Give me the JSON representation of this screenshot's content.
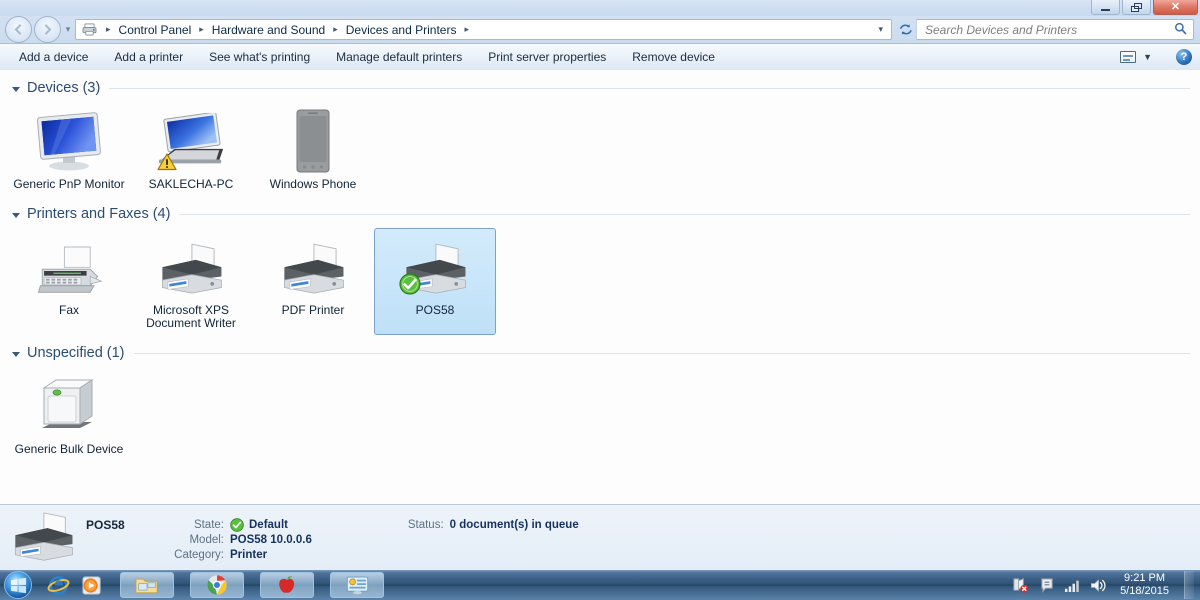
{
  "window": {
    "titlebar_buttons": {
      "minimize": "–",
      "restore": "❐",
      "close": "✕"
    }
  },
  "addressbar": {
    "back_glyph": "◄",
    "forward_glyph": "►",
    "history_glyph": "▼",
    "crumb_icon": "printer-folder-icon",
    "crumbs": [
      "Control Panel",
      "Hardware and Sound",
      "Devices and Printers"
    ],
    "separator": "►",
    "dropdown_glyph": "▼",
    "refresh_glyph": "↻",
    "search_placeholder": "Search Devices and Printers",
    "search_icon": "🔍"
  },
  "toolbar": {
    "items": [
      "Add a device",
      "Add a printer",
      "See what's printing",
      "Manage default printers",
      "Print server properties",
      "Remove device"
    ],
    "view_chevron": "▼",
    "help_label": "?"
  },
  "groups": [
    {
      "title": "Devices (3)",
      "items": [
        {
          "label": "Generic PnP Monitor",
          "icon": "monitor-icon",
          "selected": false,
          "badge": null
        },
        {
          "label": "SAKLECHA-PC",
          "icon": "laptop-icon",
          "selected": false,
          "badge": "warning"
        },
        {
          "label": "Windows Phone",
          "icon": "phone-icon",
          "selected": false,
          "badge": null
        }
      ]
    },
    {
      "title": "Printers and Faxes (4)",
      "items": [
        {
          "label": "Fax",
          "icon": "fax-icon",
          "selected": false,
          "badge": null
        },
        {
          "label": "Microsoft XPS Document Writer",
          "icon": "printer-icon",
          "selected": false,
          "badge": null
        },
        {
          "label": "PDF Printer",
          "icon": "printer-icon",
          "selected": false,
          "badge": null
        },
        {
          "label": "POS58",
          "icon": "printer-icon",
          "selected": true,
          "badge": "default-check"
        }
      ]
    },
    {
      "title": "Unspecified (1)",
      "items": [
        {
          "label": "Generic Bulk Device",
          "icon": "bulk-device-icon",
          "selected": false,
          "badge": null
        }
      ]
    }
  ],
  "details": {
    "name": "POS58",
    "rows": [
      {
        "label": "State:",
        "value": "Default",
        "has_check": true
      },
      {
        "label": "Model:",
        "value": "POS58 10.0.0.6",
        "has_check": false
      },
      {
        "label": "Category:",
        "value": "Printer",
        "has_check": false
      }
    ],
    "status_label": "Status:",
    "status_value": "0 document(s) in queue"
  },
  "taskbar": {
    "start_label": "start-orb",
    "pinned": [
      {
        "name": "internet-explorer-icon"
      },
      {
        "name": "windows-media-player-icon"
      }
    ],
    "buttons": [
      {
        "name": "windows-explorer-taskbar-button",
        "active": false
      },
      {
        "name": "google-chrome-taskbar-button",
        "active": true
      },
      {
        "name": "apple-app-taskbar-button",
        "active": false
      },
      {
        "name": "devices-and-printers-taskbar-button",
        "active": true
      }
    ],
    "tray": [
      {
        "name": "network-error-icon"
      },
      {
        "name": "action-center-icon"
      },
      {
        "name": "signal-strength-icon"
      },
      {
        "name": "volume-icon"
      }
    ],
    "clock_time": "9:21 PM",
    "clock_date": "5/18/2015"
  },
  "colors": {
    "accent": "#2b4c72",
    "selection_border": "#7da2ce",
    "close_button": "#cf5a46",
    "default_check": "#4caf2f"
  }
}
